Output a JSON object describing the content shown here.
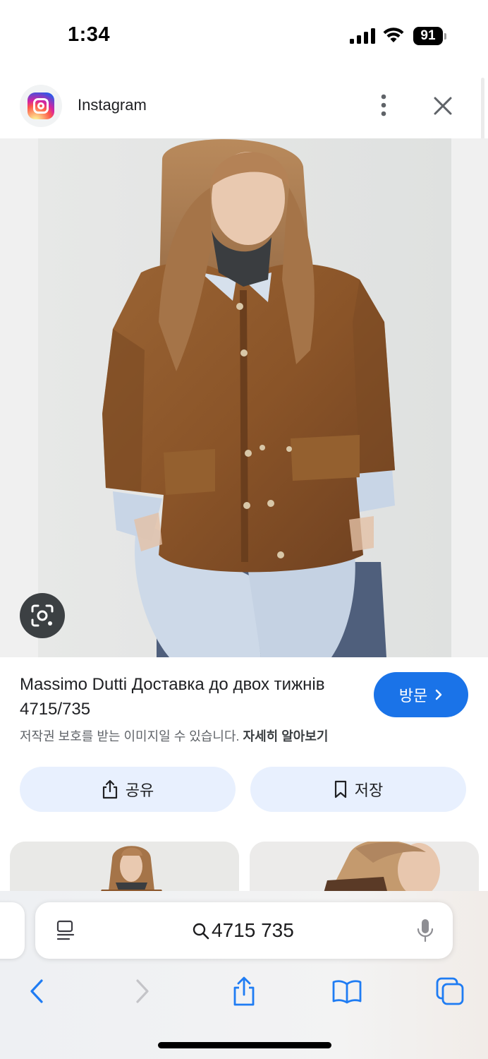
{
  "status_bar": {
    "time": "1:34",
    "battery": "91"
  },
  "source": {
    "name": "Instagram",
    "icon": "instagram-logo-icon"
  },
  "image": {
    "description_icon": "lens-icon"
  },
  "result": {
    "title": "Massimo Dutti Доставка до двох тижнів 4715/735",
    "copyright_text": "저작권 보호를 받는 이미지일 수 있습니다.",
    "copyright_link": "자세히 알아보기",
    "visit_label": "방문",
    "share_label": "공유",
    "save_label": "저장"
  },
  "browser": {
    "address": "4715 735",
    "icons": {
      "reader": "reader-icon",
      "search": "search-icon",
      "mic": "microphone-icon",
      "back": "chevron-left-icon",
      "forward": "chevron-right-icon",
      "share": "share-icon",
      "bookmarks": "book-icon",
      "tabs": "tabs-icon"
    }
  },
  "colors": {
    "accent": "#1a73e8",
    "action_bg": "#e8f0fe",
    "jacket": "#8b5a2b",
    "shirt": "#c9d6e6",
    "ios_blue": "#1f7cf3"
  }
}
